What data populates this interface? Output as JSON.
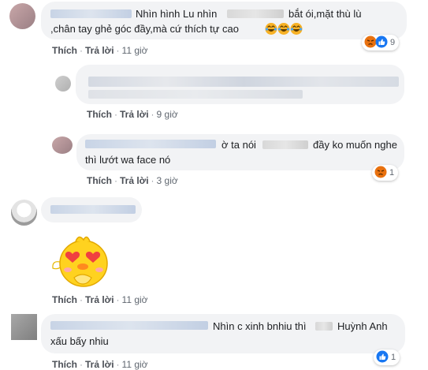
{
  "comments": [
    {
      "text_line1_a": "Nhìn hình Lu nhìn",
      "text_line1_b": "bắt ói,mặt thù lù",
      "text_line2": ",chân tay ghẻ góc đầy,mà cứ thích tự cao",
      "like_label": "Thích",
      "reply_label": "Trả lời",
      "time": "11 giờ",
      "reaction_count": "9",
      "reaction_icons": [
        "angry-icon",
        "like-icon"
      ]
    },
    {
      "like_label": "Thích",
      "reply_label": "Trả lời",
      "time": "9 giờ"
    },
    {
      "text_line1_a": "ờ ta nói",
      "text_line1_b": "đầy ko muốn nghe",
      "text_line2": "thì lướt wa face nó",
      "like_label": "Thích",
      "reply_label": "Trả lời",
      "time": "3 giờ",
      "reaction_count": "1",
      "reaction_icons": [
        "angry-icon"
      ]
    },
    {
      "sticker": "heart-eyes-chick-sticker",
      "like_label": "Thích",
      "reply_label": "Trả lời",
      "time": "11 giờ"
    },
    {
      "text_line1_a": "Nhìn c xinh bnhiu thì",
      "text_line1_b": "Huỳnh Anh",
      "text_line2": "xấu bấy nhiu",
      "like_label": "Thích",
      "reply_label": "Trả lời",
      "time": "11 giờ",
      "reaction_count": "1",
      "reaction_icons": [
        "like-icon"
      ]
    }
  ],
  "colors": {
    "bubble": "#f2f3f5",
    "angry": "#e9710f",
    "like": "#1877f2",
    "laugh": "#f7b125"
  }
}
